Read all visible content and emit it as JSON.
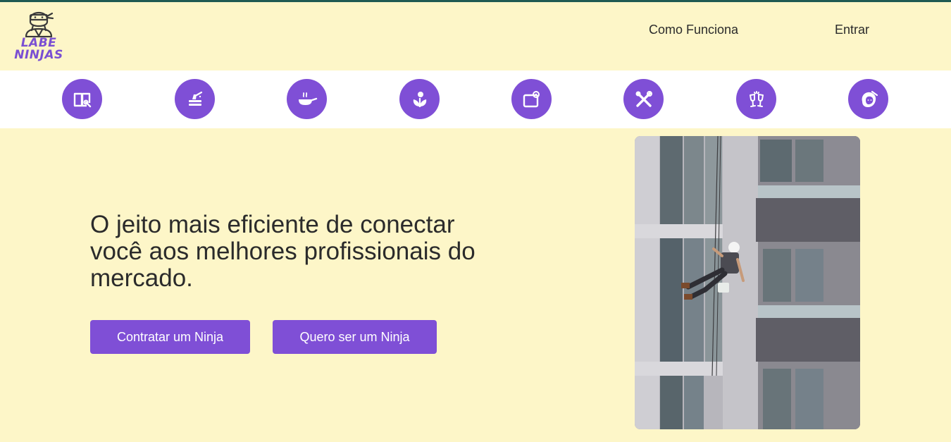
{
  "header": {
    "logo": {
      "line1": "LABE",
      "line2": "NINJAS",
      "icon": "ninja-icon"
    },
    "nav": [
      {
        "label": "Como Funciona"
      },
      {
        "label": "Entrar"
      }
    ]
  },
  "categories": [
    {
      "icon": "book-icon"
    },
    {
      "icon": "cleaning-icon"
    },
    {
      "icon": "cooking-pan-icon"
    },
    {
      "icon": "gardening-icon"
    },
    {
      "icon": "laundry-icon"
    },
    {
      "icon": "tools-icon"
    },
    {
      "icon": "party-toast-icon"
    },
    {
      "icon": "beauty-hair-icon"
    }
  ],
  "hero": {
    "title": "O jeito mais eficiente de conectar você aos melhores profissionais do mercado.",
    "primary_button": "Contratar um Ninja",
    "secondary_button": "Quero ser um Ninja"
  },
  "colors": {
    "background": "#fdf6c8",
    "accent": "#7f4fd6",
    "top_line": "#1f5a52"
  }
}
